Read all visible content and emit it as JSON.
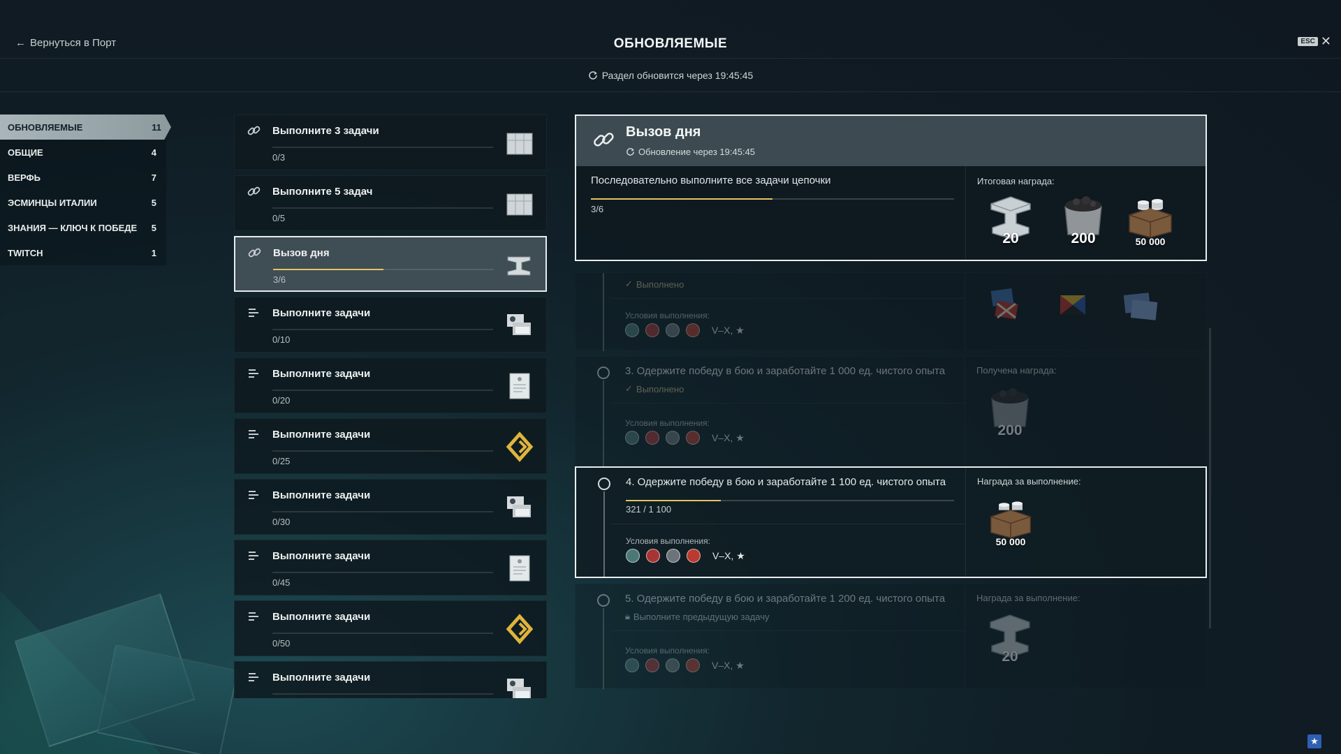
{
  "header": {
    "back_label": "Вернуться в Порт",
    "title": "ОБНОВЛЯЕМЫЕ",
    "esc_label": "ESC",
    "close_glyph": "✕",
    "refresh_text": "Раздел обновится через 19:45:45"
  },
  "sidebar": {
    "items": [
      {
        "label": "ОБНОВЛЯЕМЫЕ",
        "count": "11"
      },
      {
        "label": "ОБЩИЕ",
        "count": "4"
      },
      {
        "label": "ВЕРФЬ",
        "count": "7"
      },
      {
        "label": "ЭСМИНЦЫ ИТАЛИИ",
        "count": "5"
      },
      {
        "label": "ЗНАНИЯ — КЛЮЧ К ПОБЕДЕ",
        "count": "5"
      },
      {
        "label": "TWITCH",
        "count": "1"
      }
    ]
  },
  "tasks": [
    {
      "title": "Выполните 3 задачи",
      "progress": "0/3",
      "fraction": 0,
      "icon": "chain-link-icon",
      "reward": "crate-icon"
    },
    {
      "title": "Выполните 5 задач",
      "progress": "0/5",
      "fraction": 0,
      "icon": "chain-link-icon",
      "reward": "crate-icon"
    },
    {
      "title": "Вызов дня",
      "progress": "3/6",
      "fraction": 0.5,
      "icon": "chain-link-icon",
      "reward": "steel-icon"
    },
    {
      "title": "Выполните задачи",
      "progress": "0/10",
      "fraction": 0,
      "icon": "list-icon",
      "reward": "cards-icon"
    },
    {
      "title": "Выполните задачи",
      "progress": "0/20",
      "fraction": 0,
      "icon": "list-icon",
      "reward": "document-icon"
    },
    {
      "title": "Выполните задачи",
      "progress": "0/25",
      "fraction": 0,
      "icon": "list-icon",
      "reward": "diamond-icon"
    },
    {
      "title": "Выполните задачи",
      "progress": "0/30",
      "fraction": 0,
      "icon": "list-icon",
      "reward": "cards-icon"
    },
    {
      "title": "Выполните задачи",
      "progress": "0/45",
      "fraction": 0,
      "icon": "list-icon",
      "reward": "document-icon"
    },
    {
      "title": "Выполните задачи",
      "progress": "0/50",
      "fraction": 0,
      "icon": "list-icon",
      "reward": "diamond-icon"
    },
    {
      "title": "Выполните задачи",
      "progress": "",
      "fraction": 0,
      "icon": "list-icon",
      "reward": "cards-icon"
    }
  ],
  "detail": {
    "title": "Вызов дня",
    "update_text": "Обновление через 19:45:45",
    "description": "Последовательно выполните все задачи цепочки",
    "progress": "3/6",
    "fraction": 0.5,
    "final_reward_label": "Итоговая награда:",
    "final_rewards": [
      {
        "icon": "steel-icon",
        "qty": "20"
      },
      {
        "icon": "coal-icon",
        "qty": "200"
      },
      {
        "icon": "credits-crate-icon",
        "qty": "50 000"
      }
    ],
    "steps": [
      {
        "title": "",
        "done_text": "Выполнено",
        "conditions_label": "Условия выполнения:",
        "tier_text": "V–X, ★",
        "reward_icons": [
          "signal-flags-icon",
          "signal-flag-icon",
          "camouflage-icon"
        ]
      },
      {
        "title": "3. Одержите победу в бою и заработайте 1 000 ед. чистого опыта",
        "done_text": "Выполнено",
        "conditions_label": "Условия выполнения:",
        "tier_text": "V–X, ★",
        "reward_label": "Получена награда:",
        "reward_qty": "200"
      },
      {
        "title": "4. Одержите победу в бою и заработайте 1 100 ед. чистого опыта",
        "progress": "321 / 1 100",
        "fraction": 0.29,
        "conditions_label": "Условия выполнения:",
        "tier_text": "V–X, ★",
        "reward_label": "Награда за выполнение:",
        "reward_qty": "50 000"
      },
      {
        "title": "5. Одержите победу в бою и заработайте 1 200 ед. чистого опыта",
        "lock_text": "Выполните предыдущую задачу",
        "conditions_label": "Условия выполнения:",
        "tier_text": "V–X, ★",
        "reward_label": "Награда за выполнение:",
        "reward_qty": "20"
      }
    ]
  },
  "colors": {
    "accent": "#e5c45f",
    "selected_border": "#e9eef0",
    "nav_active": "#a9b5b8"
  }
}
